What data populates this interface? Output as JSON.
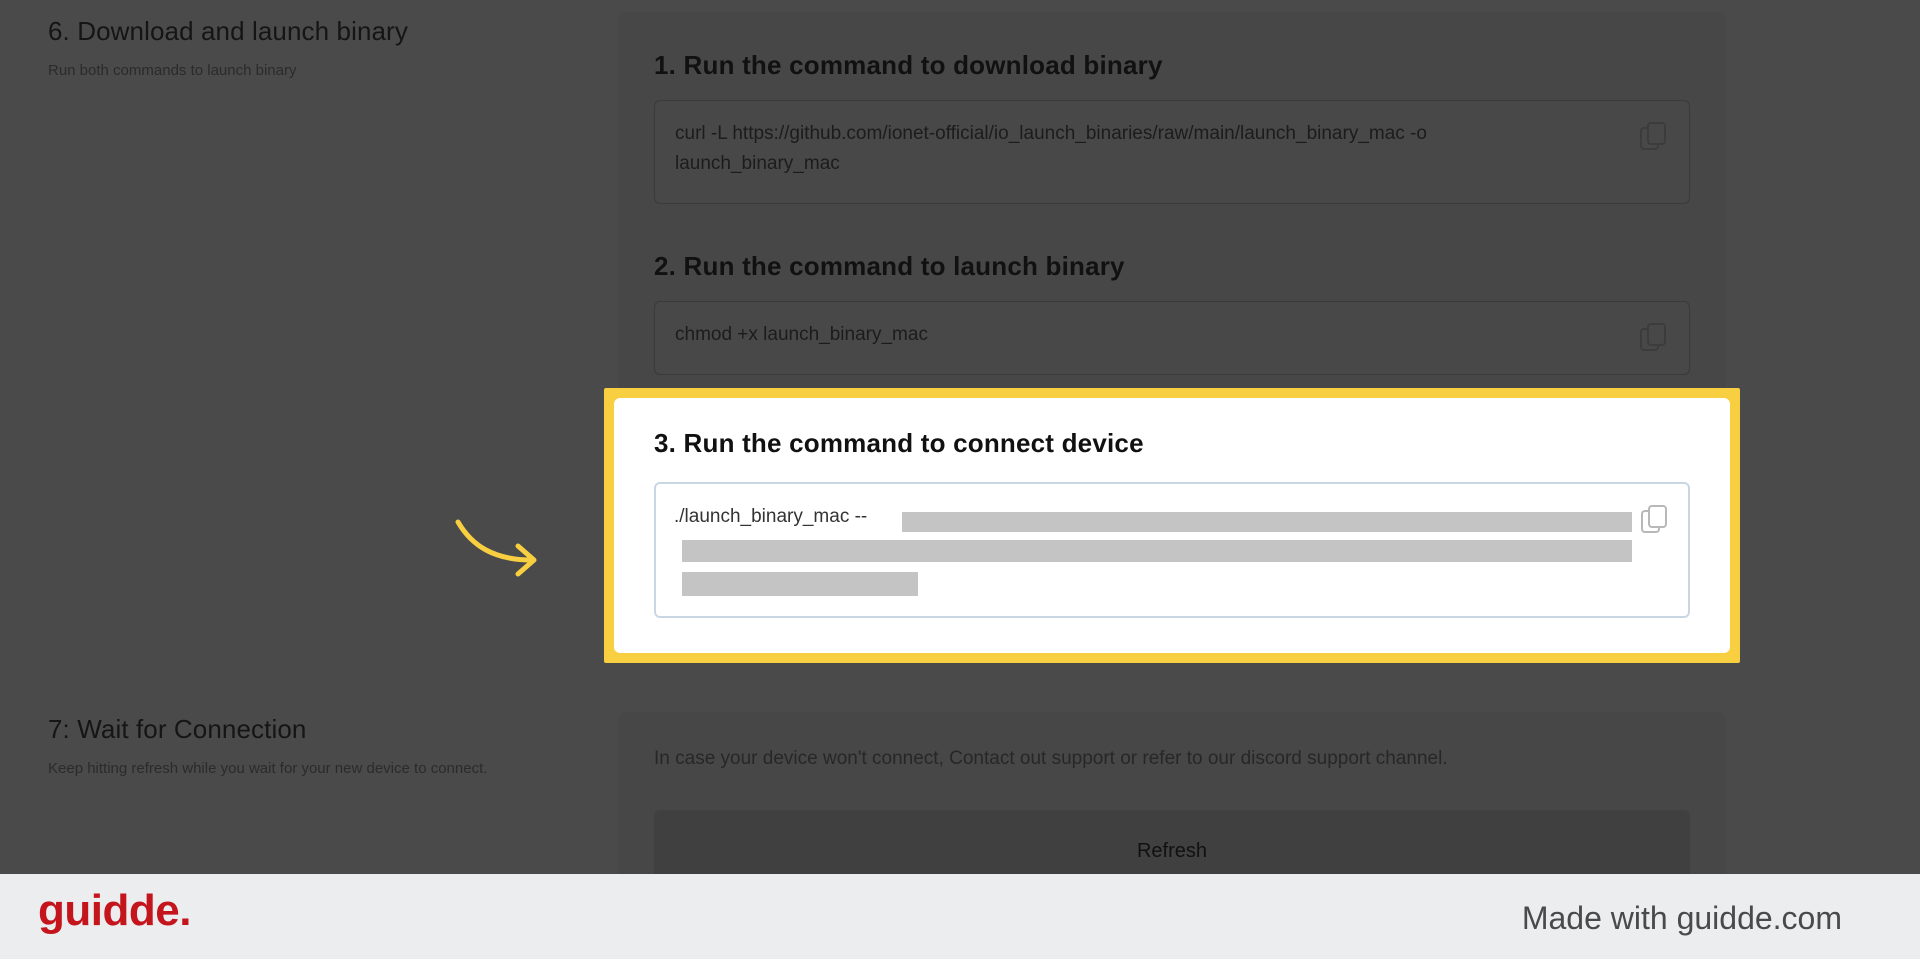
{
  "section6": {
    "title": "6. Download and launch binary",
    "desc": "Run both commands to launch binary"
  },
  "steps": [
    {
      "title": "1. Run the command to download binary",
      "command": "curl -L https://github.com/ionet-official/io_launch_binaries/raw/main/launch_binary_mac -o launch_binary_mac",
      "copy_icon": "copy-icon"
    },
    {
      "title": "2. Run the command to launch binary",
      "command": "chmod +x launch_binary_mac",
      "copy_icon": "copy-icon"
    },
    {
      "title": "3. Run the command to connect device",
      "command": "./launch_binary_mac --",
      "copy_icon": "copy-icon"
    }
  ],
  "section7": {
    "title": "7: Wait for Connection",
    "desc": "Keep hitting refresh while you wait for your new device to connect.",
    "support_text": "In case your device won't connect, Contact out support or refer to our discord support channel.",
    "refresh_label": "Refresh"
  },
  "footer": {
    "brand": "guidde.",
    "made_with": "Made with guidde.com"
  },
  "colors": {
    "highlight": "#f8cf40",
    "brand": "#c4141c",
    "overlay": "#4a4a4a"
  }
}
